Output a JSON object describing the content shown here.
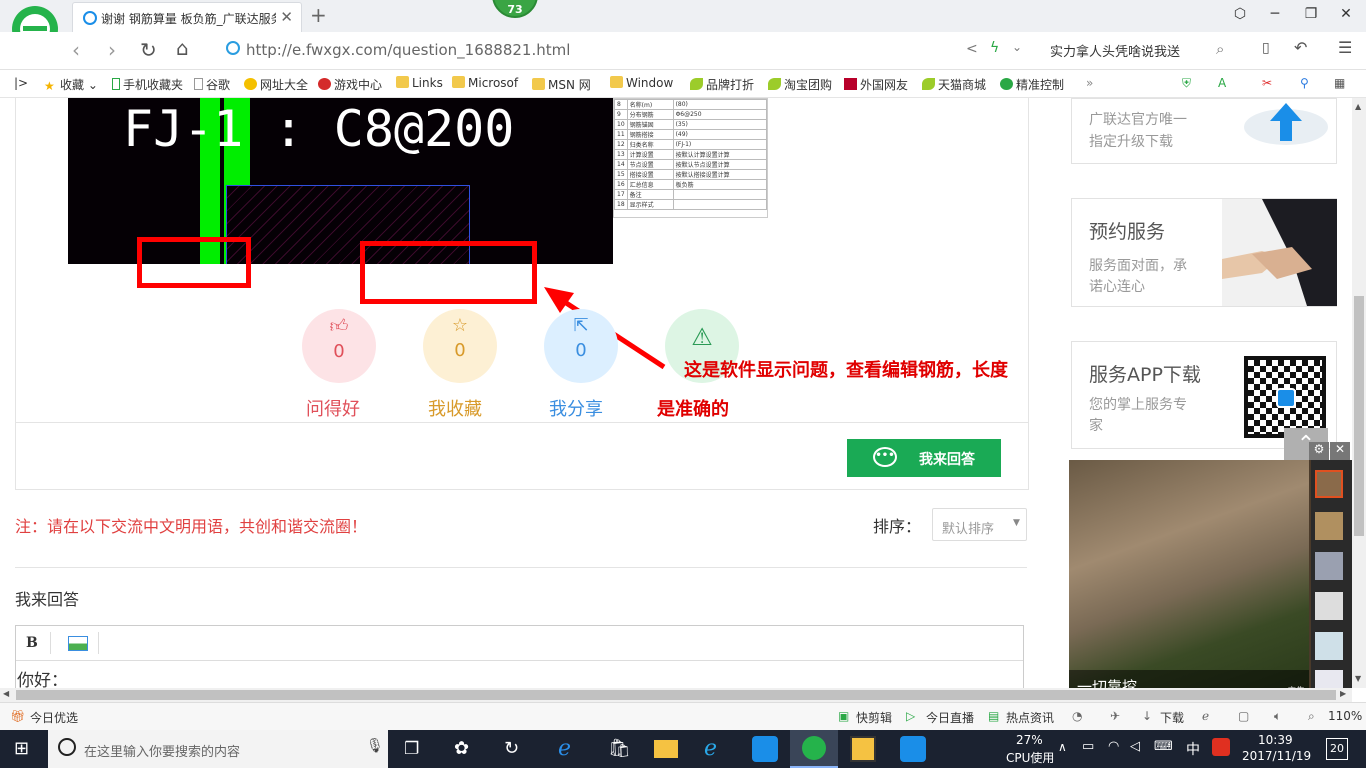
{
  "browser": {
    "tab_title": "谢谢 钢筋算量 板负筋_广联达服务",
    "badge": "73",
    "url": "http://e.fwxgx.com/question_1688821.html",
    "search_text": "实力拿人头凭啥说我送"
  },
  "bookmarks": [
    "收藏",
    "手机收藏夹",
    "谷歌",
    "网址大全",
    "游戏中心",
    "Links",
    "Microsof",
    "MSN 网",
    "Window",
    "品牌打折",
    "淘宝团购",
    "外国网友",
    "天猫商城",
    "精准控制"
  ],
  "image": {
    "cad_text": "FJ-1 : C8@200",
    "table_rows": [
      [
        "8",
        "名称(m)",
        "(80)"
      ],
      [
        "9",
        "分布钢筋",
        "Φ6@250"
      ],
      [
        "10",
        "钢筋锚固",
        "(35)"
      ],
      [
        "11",
        "钢筋搭接",
        "(49)"
      ],
      [
        "12",
        "归类名称",
        "(FJ-1)"
      ],
      [
        "13",
        "计算设置",
        "按默认计算设置计算"
      ],
      [
        "14",
        "节点设置",
        "按默认节点设置计算"
      ],
      [
        "15",
        "搭接设置",
        "按默认搭接设置计算"
      ],
      [
        "16",
        "汇总信息",
        "板负筋"
      ],
      [
        "17",
        "备注",
        ""
      ],
      [
        "18",
        "显示样式",
        ""
      ]
    ]
  },
  "annotation": {
    "line1": "这是软件显示问题，查看编辑钢筋，长度",
    "line2": "是准确的"
  },
  "actions": [
    {
      "label": "问得好",
      "count": "0",
      "icon": "thumbs-up-icon",
      "color": "#e0505a",
      "bg": "#fde3e6"
    },
    {
      "label": "我收藏",
      "count": "0",
      "icon": "star-icon",
      "color": "#d89a2a",
      "bg": "#fdf0d4"
    },
    {
      "label": "我分享",
      "count": "0",
      "icon": "share-icon",
      "color": "#3a8ee0",
      "bg": "#dcefff"
    },
    {
      "label": "",
      "count": "",
      "icon": "warning-icon",
      "color": "#2a9a55",
      "bg": "#ddf5e4"
    }
  ],
  "answer_button": "我来回答",
  "notice": "注：请在以下交流中文明用语，共创和谐交流圈！",
  "sort": {
    "label": "排序：",
    "value": "默认排序"
  },
  "reply_title": "我来回答",
  "editor": {
    "bold": "B",
    "content": "你好："
  },
  "sidebar": {
    "card1": {
      "line1": "广联达官方唯一",
      "line2": "指定升级下载"
    },
    "card2": {
      "title": "预约服务",
      "line1": "服务面对面，承",
      "line2": "诺心连心"
    },
    "card3": {
      "title": "服务APP下载",
      "line1": "您的掌上服务专",
      "line2": "家"
    }
  },
  "video_ad": {
    "caption": "一切靠挖",
    "tag": "广告"
  },
  "statusbar": {
    "left": "今日优选",
    "items": [
      "快剪辑",
      "今日直播",
      "热点资讯",
      "下载"
    ],
    "zoom": "110%"
  },
  "taskbar": {
    "search_placeholder": "在这里输入你要搜索的内容",
    "cpu_percent": "27%",
    "cpu_label": "CPU使用",
    "ime": "中",
    "time": "10:39",
    "date": "2017/11/19",
    "notifications": "20"
  },
  "colors": {
    "accent_green": "#1aaa55",
    "annotation_red": "#e00000"
  }
}
